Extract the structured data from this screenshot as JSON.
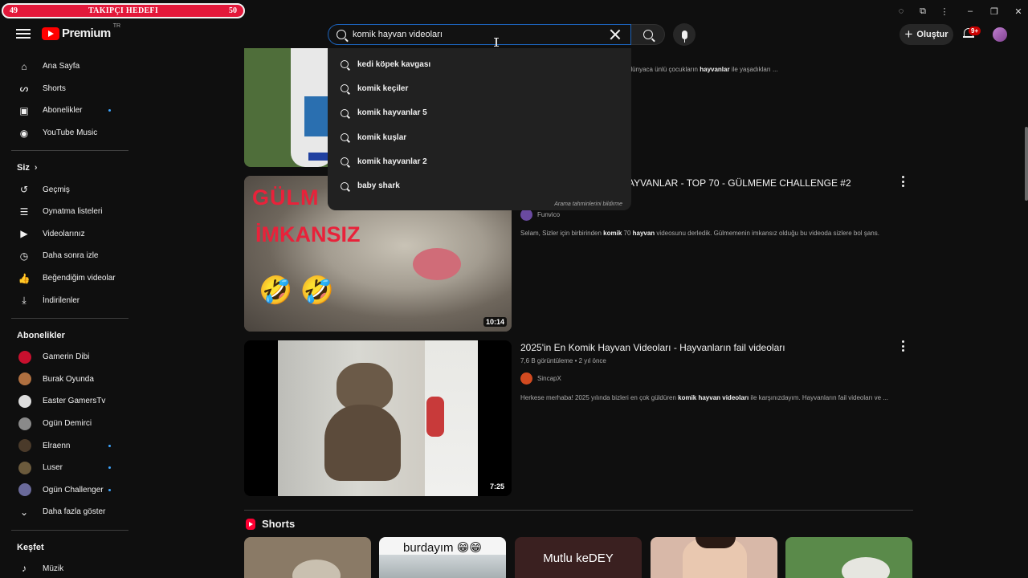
{
  "overlay": {
    "goal_title": "TAKIPÇI HEDEFI",
    "current": "49",
    "target": "50",
    "watermark": "T????? ?????? ?? ?????"
  },
  "header": {
    "logo_text": "Premium",
    "logo_country": "TR",
    "search": {
      "value": "komik hayvan videoları"
    },
    "create_label": "Oluştur",
    "notification_badge": "9+"
  },
  "suggestions": {
    "items": [
      "kedi köpek kavgası",
      "komik keçiler",
      "komik hayvanlar 5",
      "komik kuşlar",
      "komik hayvanlar 2",
      "baby shark"
    ],
    "report_label": "Arama tahminlerini bildirme"
  },
  "sidebar": {
    "main": [
      {
        "label": "Ana Sayfa",
        "icon": "home-icon"
      },
      {
        "label": "Shorts",
        "icon": "shorts-icon"
      },
      {
        "label": "Abonelikler",
        "icon": "subscriptions-icon",
        "dot": true
      },
      {
        "label": "YouTube Music",
        "icon": "music-icon"
      }
    ],
    "you_title": "Siz",
    "you": [
      {
        "label": "Geçmiş",
        "icon": "history-icon"
      },
      {
        "label": "Oynatma listeleri",
        "icon": "playlist-icon"
      },
      {
        "label": "Videolarınız",
        "icon": "your-videos-icon"
      },
      {
        "label": "Daha sonra izle",
        "icon": "watch-later-icon"
      },
      {
        "label": "Beğendiğim videolar",
        "icon": "like-icon"
      },
      {
        "label": "İndirilenler",
        "icon": "download-icon"
      }
    ],
    "subs_title": "Abonelikler",
    "subs": [
      {
        "label": "Gamerin Dibi",
        "color": "#c8102e"
      },
      {
        "label": "Burak Oyunda",
        "color": "#b07040"
      },
      {
        "label": "Easter GamersTv",
        "color": "#dddddd"
      },
      {
        "label": "Ogün Demirci",
        "color": "#8a8a8a"
      },
      {
        "label": "Elraenn",
        "color": "#4a3a2a",
        "dot": true
      },
      {
        "label": "Luser",
        "color": "#6b5a3c",
        "dot": true
      },
      {
        "label": "Ogün Challenger",
        "color": "#6a6a9a",
        "dot": true
      }
    ],
    "show_more": "Daha fazla göster",
    "explore_title": "Keşfet",
    "explore": [
      {
        "label": "Müzik",
        "icon": "music-note-icon"
      }
    ]
  },
  "videos": [
    {
      "title": "",
      "meta": "",
      "channel": "",
      "desc_html": "...izimize biraz eğlence katalım dedik, dünyaca ünlü çocukların <b>hayvanlar</b> ile yaşadıkları ...",
      "duration": ""
    },
    {
      "title": "...AYVANLAR - TOP 70 - GÜLMEME CHALLENGE #2",
      "meta": "",
      "channel": "Funvico",
      "desc_html": "Selam, Sizler için birbirinden <b>komik</b> 70 <b>hayvan</b> videosunu derledik. Gülmemenin imkansız olduğu bu videoda sizlere bol şans.",
      "duration": "10:14",
      "thumb_text1": "GÜLM",
      "thumb_text2": "İMKANSIZ",
      "emoji": "🤣 🤣"
    },
    {
      "title": "2025'in En Komik Hayvan Videoları - Hayvanların fail videoları",
      "meta": "7,6 B görüntüleme • 2 yıl önce",
      "channel": "SincapX",
      "desc_html": "Herkese merhaba! 2025 yılında bizleri en çok güldüren <b>komik hayvan videoları</b> ile karşınızdayım. Hayvanların fail videoları ve ...",
      "duration": "7:25"
    }
  ],
  "shorts": {
    "title": "Shorts",
    "cards": [
      {
        "text": "",
        "bg": "#8a7a66"
      },
      {
        "text": "burdayım 😁😁",
        "bg": "#f5f5f5",
        "fg": "#111111"
      },
      {
        "text": "Mutlu keDEY",
        "bg": "#3a2020",
        "fg": "#ffffff"
      },
      {
        "text": "",
        "bg": "#d8b8a8"
      },
      {
        "text": "",
        "bg": "#5a8a4a"
      }
    ]
  }
}
